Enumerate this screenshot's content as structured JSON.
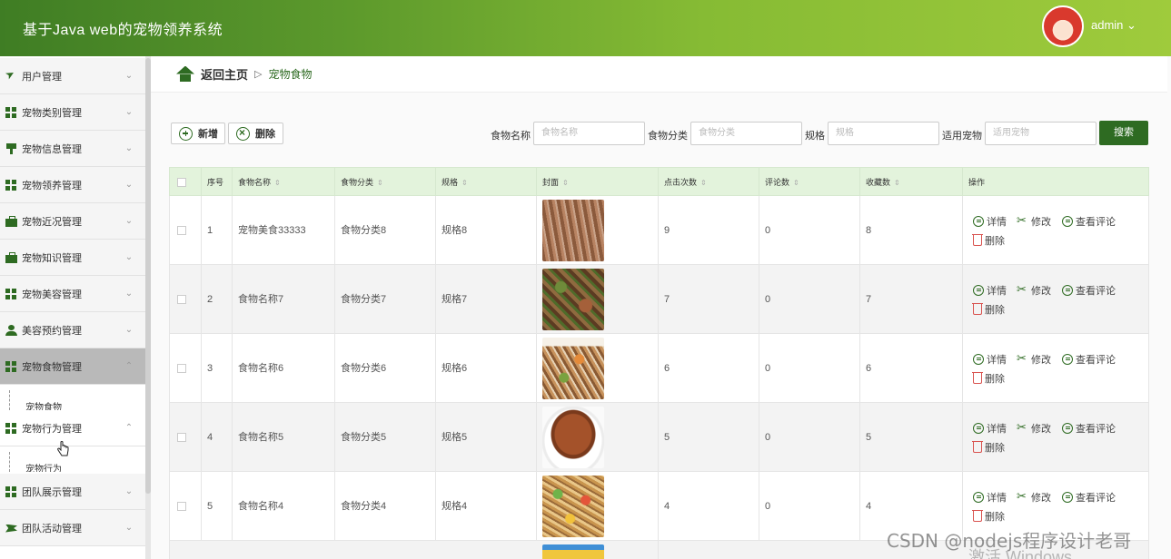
{
  "header": {
    "title": "基于Java web的宠物领养系统",
    "user": "admin ⌄"
  },
  "sidebar": {
    "items": [
      {
        "label": "用户管理",
        "icon": "paper-plane-icon"
      },
      {
        "label": "宠物类别管理",
        "icon": "grid-icon"
      },
      {
        "label": "宠物信息管理",
        "icon": "pin-icon"
      },
      {
        "label": "宠物领养管理",
        "icon": "grid-icon"
      },
      {
        "label": "宠物近况管理",
        "icon": "briefcase-icon"
      },
      {
        "label": "宠物知识管理",
        "icon": "briefcase-icon"
      },
      {
        "label": "宠物美容管理",
        "icon": "grid-icon"
      },
      {
        "label": "美容预约管理",
        "icon": "person-icon"
      },
      {
        "label": "宠物食物管理",
        "icon": "grid-icon"
      },
      {
        "label": "宠物行为管理",
        "icon": "grid-icon"
      },
      {
        "label": "团队展示管理",
        "icon": "grid-icon"
      },
      {
        "label": "团队活动管理",
        "icon": "flag-icon"
      }
    ],
    "sub_food": "宠物食物",
    "sub_behavior": "宠物行为"
  },
  "breadcrumb": {
    "home": "返回主页",
    "sep": "▷",
    "current": "宠物食物"
  },
  "toolbar": {
    "add_label": "新增",
    "delete_label": "删除",
    "search_label": "搜索",
    "filters": [
      {
        "label": "食物名称",
        "placeholder": "食物名称"
      },
      {
        "label": "食物分类",
        "placeholder": "食物分类"
      },
      {
        "label": "规格",
        "placeholder": "规格"
      },
      {
        "label": "适用宠物",
        "placeholder": "适用宠物"
      }
    ]
  },
  "table": {
    "headers": [
      "序号",
      "食物名称",
      "食物分类",
      "规格",
      "封面",
      "点击次数",
      "评论数",
      "收藏数",
      "操作"
    ],
    "rows": [
      {
        "index": "1",
        "name": "宠物美食33333",
        "category": "食物分类8",
        "spec": "规格8",
        "clicks": "9",
        "comments": "0",
        "favorites": "8"
      },
      {
        "index": "2",
        "name": "食物名称7",
        "category": "食物分类7",
        "spec": "规格7",
        "clicks": "7",
        "comments": "0",
        "favorites": "7"
      },
      {
        "index": "3",
        "name": "食物名称6",
        "category": "食物分类6",
        "spec": "规格6",
        "clicks": "6",
        "comments": "0",
        "favorites": "6"
      },
      {
        "index": "4",
        "name": "食物名称5",
        "category": "食物分类5",
        "spec": "规格5",
        "clicks": "5",
        "comments": "0",
        "favorites": "5"
      },
      {
        "index": "5",
        "name": "食物名称4",
        "category": "食物分类4",
        "spec": "规格4",
        "clicks": "4",
        "comments": "0",
        "favorites": "4"
      }
    ],
    "ops": {
      "detail": "详情",
      "edit": "修改",
      "comments": "查看评论",
      "delete": "删除"
    }
  },
  "watermark": "CSDN @nodejs程序设计老哥",
  "windows_mark": "激活 Windows",
  "colors": {
    "brand": "#2e6b22",
    "header_end": "#9fcb3c",
    "table_head": "#e3f3dc",
    "danger": "#d9534f"
  }
}
